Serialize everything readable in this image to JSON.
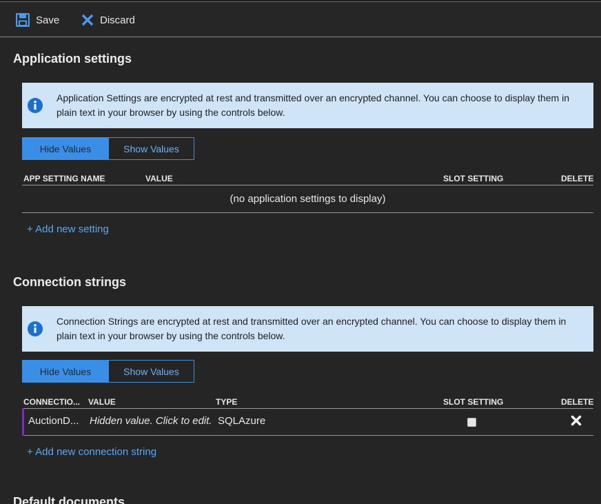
{
  "toolbar": {
    "save_label": "Save",
    "discard_label": "Discard",
    "save_icon": "floppy-disk-icon",
    "discard_icon": "close-x-icon"
  },
  "app_settings": {
    "title": "Application settings",
    "info_text": "Application Settings are encrypted at rest and transmitted over an encrypted channel. You can choose to display them in plain text in your browser by using the controls below.",
    "toggle": {
      "hide_label": "Hide Values",
      "show_label": "Show Values",
      "selected": "Hide Values"
    },
    "columns": {
      "name": "APP SETTING NAME",
      "value": "VALUE",
      "slot": "SLOT SETTING",
      "delete": "DELETE"
    },
    "empty_text": "(no application settings to display)",
    "add_label": "+ Add new setting"
  },
  "connection_strings": {
    "title": "Connection strings",
    "info_text": "Connection Strings are encrypted at rest and transmitted over an encrypted channel. You can choose to display them in plain text in your browser by using the controls below.",
    "toggle": {
      "hide_label": "Hide Values",
      "show_label": "Show Values",
      "selected": "Hide Values"
    },
    "columns": {
      "name": "CONNECTIO...",
      "value": "VALUE",
      "type": "TYPE",
      "slot": "SLOT SETTING",
      "delete": "DELETE"
    },
    "rows": [
      {
        "name": "AuctionD...",
        "value": "Hidden value. Click to edit.",
        "type": "SQLAzure",
        "slot_setting": false
      }
    ],
    "add_label": "+ Add new connection string"
  },
  "default_documents": {
    "title": "Default documents"
  },
  "colors": {
    "background": "#252525",
    "accent": "#3a8ee6",
    "link": "#5aa8f0",
    "info_bg": "#cfe4f7",
    "row_marker": "#7b2fb8"
  }
}
